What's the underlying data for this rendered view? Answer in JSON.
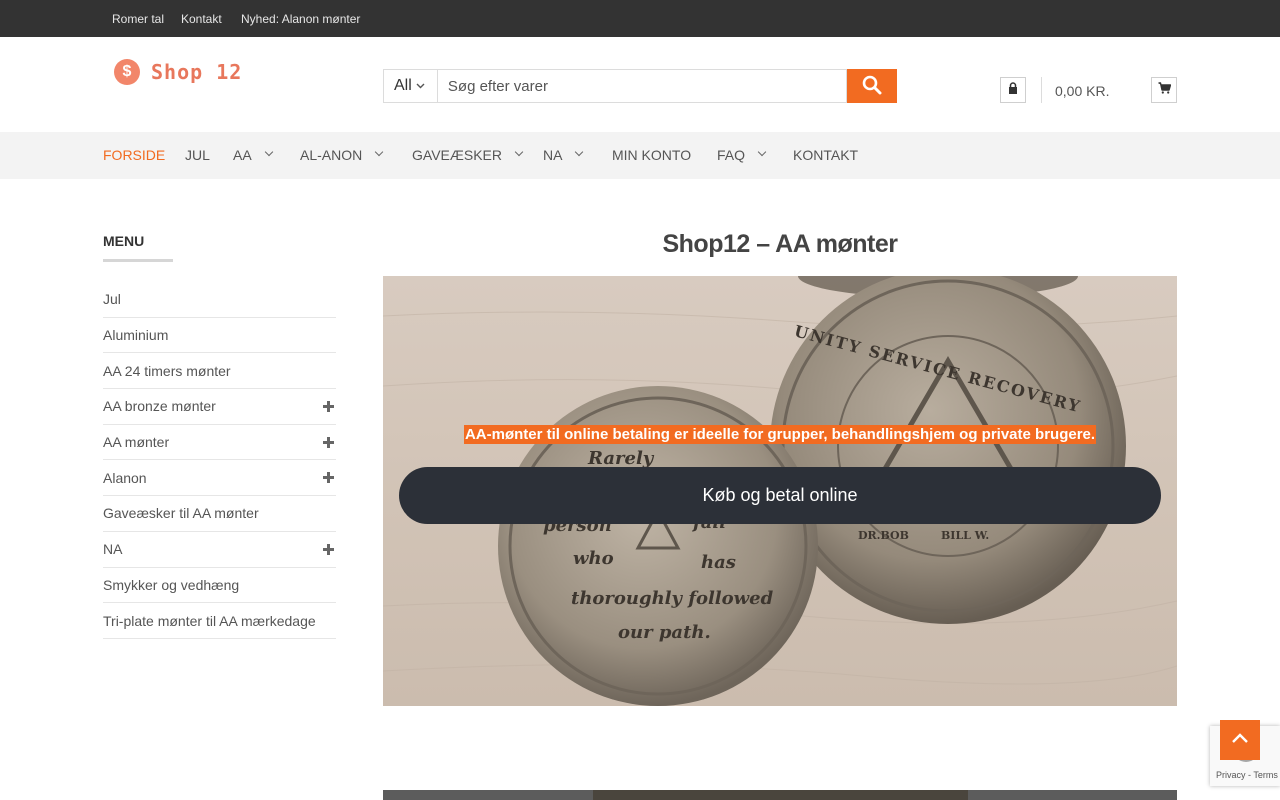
{
  "topbar": {
    "links": [
      "Romer tal",
      "Kontakt",
      "Nyhed: Alanon mønter"
    ]
  },
  "header": {
    "logo_text": "Shop 12",
    "search": {
      "category": "All",
      "placeholder": "Søg efter varer"
    },
    "cart_total": "0,00 KR."
  },
  "nav": {
    "items": [
      "Forside",
      "Jul",
      "AA",
      "AL-Anon",
      "Gaveæsker",
      "NA",
      "Min konto",
      "FAQ",
      "Kontakt"
    ]
  },
  "sidebar": {
    "title": "MENU",
    "items": [
      "Jul",
      "Aluminium",
      "AA 24 timers mønter",
      "AA bronze mønter",
      "AA mønter",
      "Alanon",
      "Gaveæsker til AA mønter",
      "NA",
      "Smykker og vedhæng",
      "Tri-plate mønter til AA mærkedage"
    ]
  },
  "main": {
    "title": "Shop12 – AA mønter",
    "hero_caption": "AA-mønter til online betaling er ideelle for grupper, behandlingshjem og private brugere.",
    "hero_button": "Køb og betal online",
    "coin_left_text": [
      "Rarely",
      "person",
      "fail",
      "who",
      "has",
      "thoroughly followed",
      "our path."
    ],
    "coin_right_text": [
      "UNITY SERVICE RECOVERY",
      "DR.BOB",
      "BILL W."
    ]
  },
  "recaptcha": {
    "terms": "Privacy - Terms"
  },
  "colors": {
    "accent": "#f26b21",
    "topbar": "#333333",
    "nav_bg": "#f3f3f3",
    "button_dark": "#2c3038"
  }
}
